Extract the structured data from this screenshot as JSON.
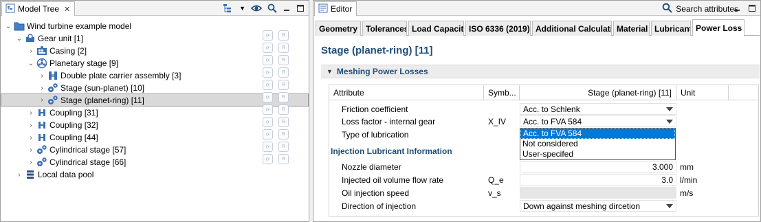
{
  "model_tree": {
    "title": "Model Tree",
    "items": [
      {
        "label": "Wind turbine example model",
        "icon": "folder-icon"
      },
      {
        "label": "Gear unit [1]",
        "icon": "gear-unit-icon"
      },
      {
        "label": "Casing [2]",
        "icon": "casing-icon"
      },
      {
        "label": "Planetary stage [9]",
        "icon": "planetary-stage-icon"
      },
      {
        "label": "Double plate carrier assembly [3]",
        "icon": "carrier-icon"
      },
      {
        "label": "Stage (sun-planet) [10]",
        "icon": "gear-pair-icon"
      },
      {
        "label": "Stage (planet-ring) [11]",
        "icon": "gear-pair-icon"
      },
      {
        "label": "Coupling [31]",
        "icon": "coupling-icon"
      },
      {
        "label": "Coupling [32]",
        "icon": "coupling-icon"
      },
      {
        "label": "Coupling [44]",
        "icon": "coupling-icon"
      },
      {
        "label": "Cylindrical stage [57]",
        "icon": "gear-pair-icon"
      },
      {
        "label": "Cylindrical stage [66]",
        "icon": "gear-pair-icon"
      },
      {
        "label": "Local data pool",
        "icon": "database-icon"
      }
    ]
  },
  "editor": {
    "title": "Editor",
    "search_label": "Search attributes",
    "tabs": [
      "Geometry",
      "Tolerances",
      "Load Capacity",
      "ISO 6336 (2019)",
      "Additional Calculati",
      "Material",
      "Lubricant",
      "Power Loss"
    ],
    "active_tab": "Power Loss",
    "page_title": "Stage (planet-ring) [11]",
    "section_title": "Meshing Power Losses",
    "columns": {
      "attribute": "Attribute",
      "symbol": "Symb...",
      "value": "Stage (planet-ring) [11]",
      "unit": "Unit"
    },
    "rows": [
      {
        "attribute": "Friction coefficient",
        "symbol": "",
        "value": "Acc. to Schlenk",
        "unit": ""
      },
      {
        "attribute": "Loss factor - internal gear",
        "symbol": "X_IV",
        "value": "Acc. to FVA 584",
        "unit": ""
      },
      {
        "attribute": "Type of lubrication",
        "symbol": "",
        "value": "",
        "unit": ""
      }
    ],
    "group2_title": "Injection Lubricant Information",
    "rows2": [
      {
        "attribute": "Nozzle diameter",
        "symbol": "",
        "value": "3.000",
        "unit": "mm"
      },
      {
        "attribute": "Injected oil volume flow rate",
        "symbol": "Q_e",
        "value": "3.0",
        "unit": "l/min"
      },
      {
        "attribute": "Oil injection speed",
        "symbol": "v_s",
        "value": "",
        "unit": "m/s"
      },
      {
        "attribute": "Direction of injection",
        "symbol": "",
        "value": "Down against meshing dircetion",
        "unit": ""
      }
    ],
    "dropdown_options": [
      "Acc. to FVA 584",
      "Not considered",
      "User-specifed"
    ],
    "dropdown_selected": "Acc. to FVA 584"
  },
  "colors": {
    "title_blue": "#1f4e79",
    "selection_blue": "#0078d7",
    "icon_blue": "#3c6fb4"
  }
}
